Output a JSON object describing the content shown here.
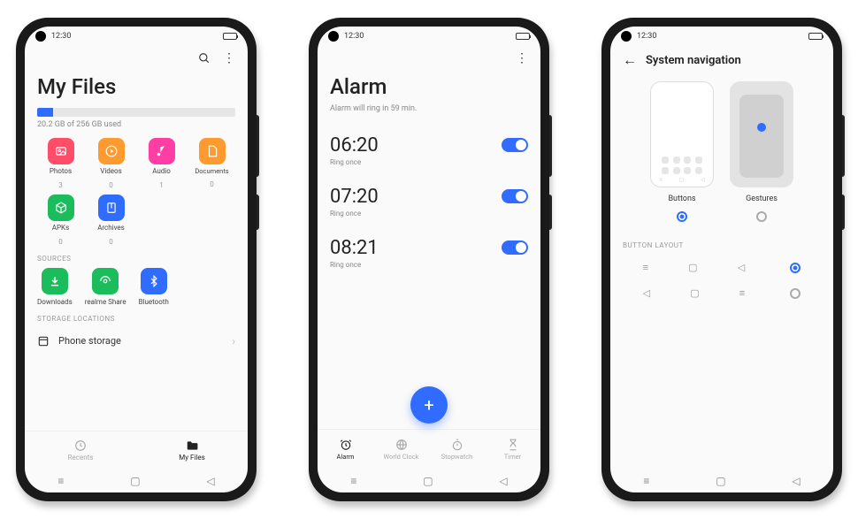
{
  "status": {
    "time": "12:30"
  },
  "files": {
    "title": "My Files",
    "storage_text": "20.2 GB of 256 GB used",
    "storage_pct": 8,
    "cats": [
      {
        "label": "Photos",
        "count": "3",
        "color": "#ff4d6a",
        "icon": "image"
      },
      {
        "label": "Videos",
        "count": "0",
        "color": "#ff9a2e",
        "icon": "play"
      },
      {
        "label": "Audio",
        "count": "1",
        "color": "#ff3ea5",
        "icon": "note"
      },
      {
        "label": "Documents",
        "count": "0",
        "color": "#ff9a2e",
        "icon": "doc"
      },
      {
        "label": "APKs",
        "count": "0",
        "color": "#1abc5c",
        "icon": "cube"
      },
      {
        "label": "Archives",
        "count": "0",
        "color": "#2f6cff",
        "icon": "zip"
      }
    ],
    "sources_head": "SOURCES",
    "sources": [
      {
        "label": "Downloads",
        "color": "#1abc5c",
        "icon": "dl"
      },
      {
        "label": "realme Share",
        "color": "#1abc5c",
        "icon": "share"
      },
      {
        "label": "Bluetooth",
        "color": "#2f6cff",
        "icon": "bt"
      }
    ],
    "storage_head": "STORAGE LOCATIONS",
    "phone_storage": "Phone storage",
    "tabs": {
      "recents": "Recents",
      "myfiles": "My Files"
    }
  },
  "alarm": {
    "title": "Alarm",
    "sub": "Alarm will ring in 59 min.",
    "items": [
      {
        "time": "06:20",
        "sub": "Ring once",
        "on": true
      },
      {
        "time": "07:20",
        "sub": "Ring once",
        "on": true
      },
      {
        "time": "08:21",
        "sub": "Ring once",
        "on": true
      }
    ],
    "tabs": {
      "alarm": "Alarm",
      "world": "World Clock",
      "stopwatch": "Stopwatch",
      "timer": "Timer"
    }
  },
  "sysnav": {
    "title": "System navigation",
    "buttons_label": "Buttons",
    "gestures_label": "Gestures",
    "section": "BUTTON LAYOUT"
  }
}
